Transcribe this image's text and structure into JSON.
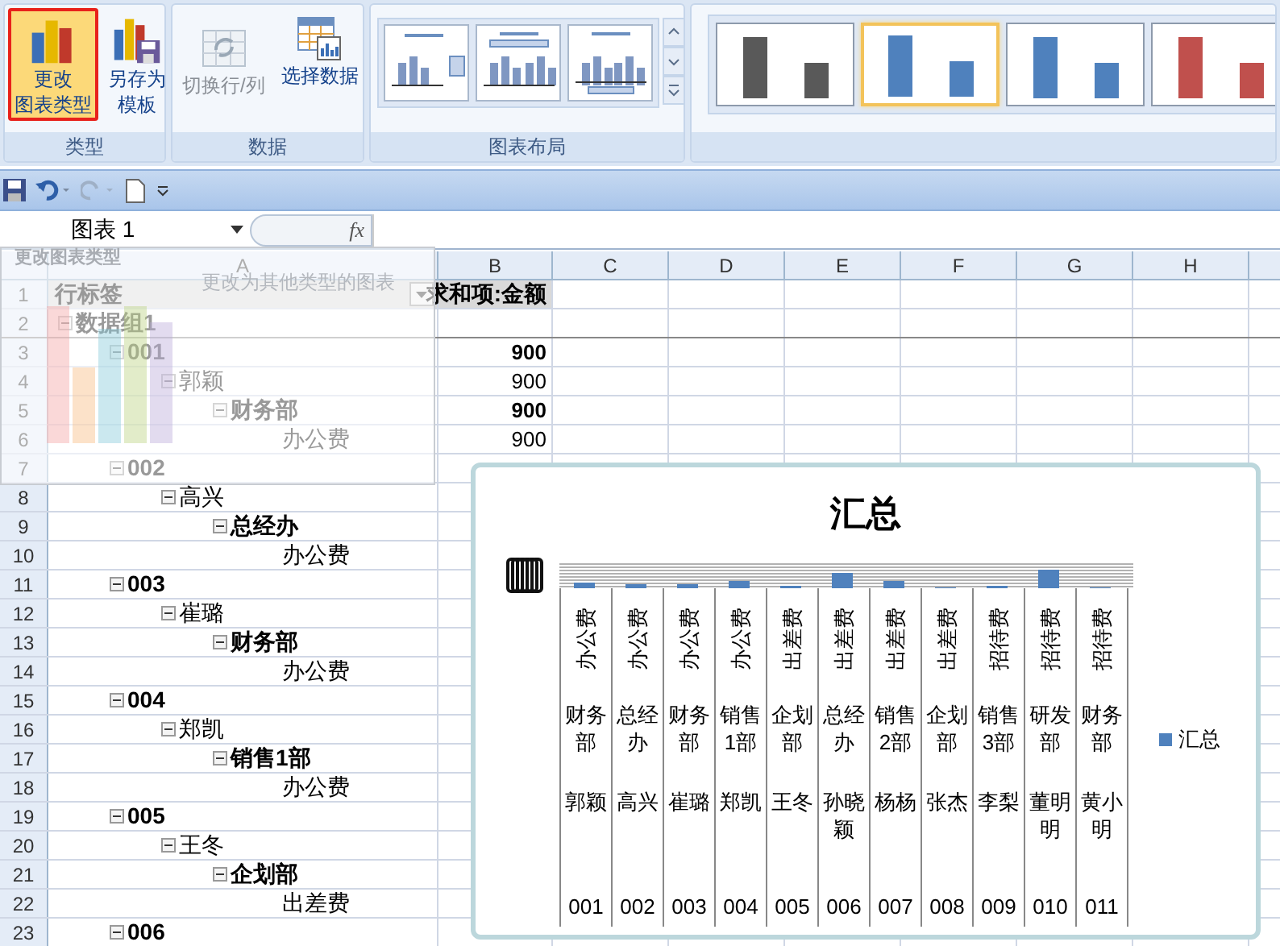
{
  "ribbon": {
    "groups": [
      {
        "label": "类型",
        "kind": "buttons",
        "buttons": [
          {
            "kind": "chart-type",
            "lines": [
              "更改",
              "图表类型"
            ],
            "highlighted": true,
            "disabled": false
          },
          {
            "kind": "save-template",
            "lines": [
              "另存为",
              "模板"
            ],
            "highlighted": false,
            "disabled": false
          }
        ]
      },
      {
        "label": "数据",
        "kind": "buttons",
        "buttons": [
          {
            "kind": "switch",
            "lines": [
              "切换行/列"
            ],
            "highlighted": false,
            "disabled": true
          },
          {
            "kind": "select-data",
            "lines": [
              "选择数据"
            ],
            "highlighted": false,
            "disabled": false
          }
        ]
      },
      {
        "label": "图表布局",
        "kind": "layouts",
        "layouts": [
          {
            "kind": "legend-right"
          },
          {
            "kind": "legend-top"
          },
          {
            "kind": "legend-bottom"
          }
        ]
      },
      {
        "kind": "styles",
        "styles": [
          {
            "color": "#595959",
            "selected": false
          },
          {
            "color": "#4f81bd",
            "selected": true
          },
          {
            "color": "#4f81bd",
            "selected": false
          },
          {
            "color": "#c0504d",
            "selected": false
          }
        ]
      }
    ]
  },
  "name_box": {
    "value": "图表 1"
  },
  "formula_bar": {
    "fx": "fx"
  },
  "tooltip": {
    "title": "更改图表类型",
    "description": "更改为其他类型的图表"
  },
  "columns": [
    "A",
    "B",
    "C",
    "D",
    "E",
    "F",
    "G",
    "H"
  ],
  "row_numbers": [
    "1",
    "2",
    "3",
    "4",
    "5",
    "6",
    "7",
    "8",
    "9",
    "10",
    "11",
    "12",
    "13",
    "14",
    "15",
    "16",
    "17",
    "18",
    "19",
    "20",
    "21",
    "22",
    "23"
  ],
  "pivot": {
    "row_label": "行标签",
    "value_header": "求和项:金额",
    "tree": [
      {
        "label": "数据组1",
        "expanded": true,
        "children": [
          {
            "label": "001",
            "value": "900",
            "expanded": true,
            "children": [
              {
                "label": "郭颖",
                "value": "900",
                "expanded": true,
                "children": [
                  {
                    "label": "财务部",
                    "value": "900",
                    "expanded": true,
                    "children": [
                      {
                        "label": "办公费",
                        "value": "900"
                      }
                    ]
                  }
                ]
              }
            ]
          },
          {
            "label": "002",
            "expanded": true,
            "children": [
              {
                "label": "高兴",
                "expanded": true,
                "children": [
                  {
                    "label": "总经办",
                    "expanded": true,
                    "children": [
                      {
                        "label": "办公费"
                      }
                    ]
                  }
                ]
              }
            ]
          },
          {
            "label": "003",
            "expanded": true,
            "children": [
              {
                "label": "崔璐",
                "expanded": true,
                "children": [
                  {
                    "label": "财务部",
                    "expanded": true,
                    "children": [
                      {
                        "label": "办公费"
                      }
                    ]
                  }
                ]
              }
            ]
          },
          {
            "label": "004",
            "expanded": true,
            "children": [
              {
                "label": "郑凯",
                "expanded": true,
                "children": [
                  {
                    "label": "销售1部",
                    "expanded": true,
                    "children": [
                      {
                        "label": "办公费"
                      }
                    ]
                  }
                ]
              }
            ]
          },
          {
            "label": "005",
            "expanded": true,
            "children": [
              {
                "label": "王冬",
                "expanded": true,
                "children": [
                  {
                    "label": "企划部",
                    "expanded": true,
                    "children": [
                      {
                        "label": "出差费"
                      }
                    ]
                  }
                ]
              }
            ]
          },
          {
            "label": "006",
            "expanded": true
          }
        ]
      }
    ]
  },
  "chart": {
    "title": "汇总",
    "legend": "汇总",
    "categories": [
      {
        "expense": "办公费",
        "dept": "财务部",
        "person": "郭颖",
        "code": "001"
      },
      {
        "expense": "办公费",
        "dept": "总经办",
        "person": "高兴",
        "code": "002"
      },
      {
        "expense": "办公费",
        "dept": "财务部",
        "person": "崔璐",
        "code": "003"
      },
      {
        "expense": "办公费",
        "dept": "销售1部",
        "person": "郑凯",
        "code": "004"
      },
      {
        "expense": "出差费",
        "dept": "企划部",
        "person": "王冬",
        "code": "005"
      },
      {
        "expense": "出差费",
        "dept": "总经办",
        "person": "孙晓颖",
        "code": "006"
      },
      {
        "expense": "出差费",
        "dept": "销售2部",
        "person": "杨杨",
        "code": "007"
      },
      {
        "expense": "出差费",
        "dept": "企划部",
        "person": "张杰",
        "code": "008"
      },
      {
        "expense": "招待费",
        "dept": "销售3部",
        "person": "李梨",
        "code": "009"
      },
      {
        "expense": "招待费",
        "dept": "研发部",
        "person": "董明明",
        "code": "010"
      },
      {
        "expense": "招待费",
        "dept": "财务部",
        "person": "黄小明",
        "code": "011"
      }
    ]
  }
}
